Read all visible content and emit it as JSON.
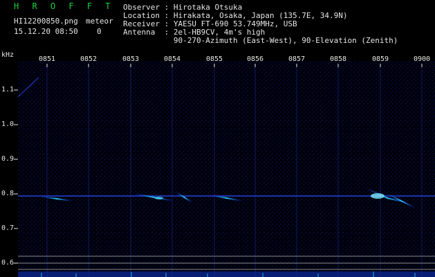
{
  "header": {
    "title": "H R O F F T",
    "filename": "HI12200850.png",
    "meteor_label": "meteor",
    "datetime": "15.12.20 08:50",
    "meteor_count": "0",
    "info_lines": [
      "Observer : Hirotaka Otsuka",
      "Location : Hirakata, Osaka, Japan (135.7E, 34.9N)",
      "Receiver : YAESU FT-690 53.749MHz, USB",
      "Antenna  : 2el-HB9CV, 4m's high",
      "           90-270-Azimuth (East-West), 90-Elevation (Zenith)"
    ]
  },
  "axis": {
    "y_unit": "kHz",
    "y_ticks": [
      "1.1",
      "1.0",
      "0.9",
      "0.8",
      "0.7",
      "0.6"
    ],
    "x_ticks": [
      "0851",
      "0852",
      "0853",
      "0854",
      "0855",
      "0856",
      "0857",
      "0858",
      "0859",
      "0900"
    ]
  },
  "colors": {
    "bg": "#000000",
    "grid": "#1a2a9a",
    "signal": "#2bd6ff",
    "text": "#e6e6e6",
    "title": "#19d43a"
  }
}
